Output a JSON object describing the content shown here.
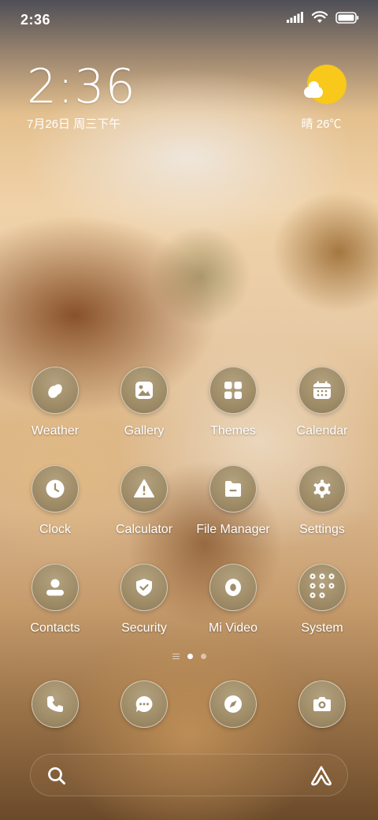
{
  "status_bar": {
    "time": "2:36",
    "icons": [
      "signal-icon",
      "wifi-icon",
      "battery-icon"
    ]
  },
  "clock_widget": {
    "time": "2:36",
    "date": "7月26日 周三下午"
  },
  "weather_widget": {
    "icon": "sunny-partly-cloudy-icon",
    "text": "晴 26℃"
  },
  "apps": [
    {
      "label": "Weather",
      "icon": "weather-icon"
    },
    {
      "label": "Gallery",
      "icon": "gallery-icon"
    },
    {
      "label": "Themes",
      "icon": "themes-icon"
    },
    {
      "label": "Calendar",
      "icon": "calendar-icon"
    },
    {
      "label": "Clock",
      "icon": "clock-icon"
    },
    {
      "label": "Calculator",
      "icon": "calculator-icon"
    },
    {
      "label": "File Manager",
      "icon": "folder-icon"
    },
    {
      "label": "Settings",
      "icon": "gear-icon"
    },
    {
      "label": "Contacts",
      "icon": "contacts-icon"
    },
    {
      "label": "Security",
      "icon": "shield-icon"
    },
    {
      "label": "Mi Video",
      "icon": "video-icon"
    },
    {
      "label": "System",
      "icon": "folder-grid-icon"
    }
  ],
  "page_indicator": {
    "pages": 2,
    "current": 1
  },
  "dock": [
    {
      "icon": "phone-icon"
    },
    {
      "icon": "message-icon"
    },
    {
      "icon": "browser-compass-icon"
    },
    {
      "icon": "camera-icon"
    }
  ],
  "search_bar": {
    "left_icon": "search-icon",
    "right_icon": "assistant-icon"
  },
  "colors": {
    "icon_bg": "#a08e6a",
    "sun": "#f8c81a",
    "text": "#ffffff"
  }
}
